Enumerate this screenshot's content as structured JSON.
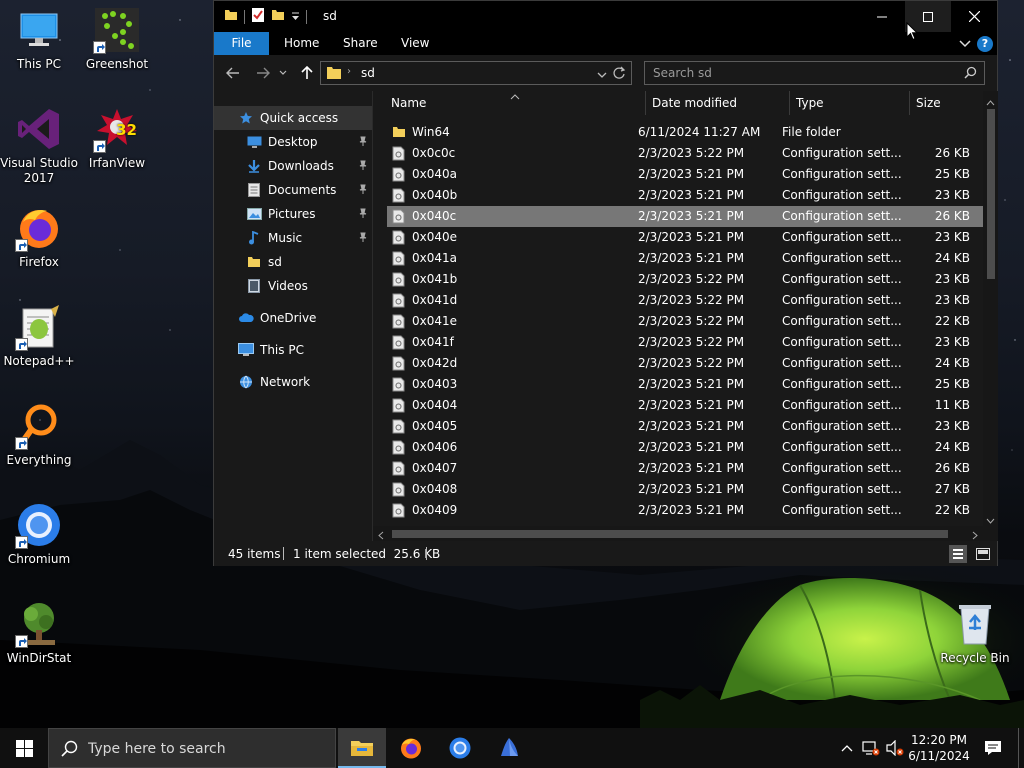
{
  "desktop": {
    "icons": [
      {
        "label": "This PC",
        "icon": "monitor-icon"
      },
      {
        "label": "Greenshot",
        "icon": "greenshot-icon"
      },
      {
        "label": "Visual Studio 2017",
        "icon": "visual-studio-icon"
      },
      {
        "label": "IrfanView",
        "icon": "irfanview-icon",
        "badge": "32"
      },
      {
        "label": "Firefox",
        "icon": "firefox-icon"
      },
      {
        "label": "Notepad++",
        "icon": "notepadpp-icon"
      },
      {
        "label": "Everything",
        "icon": "everything-icon"
      },
      {
        "label": "Chromium",
        "icon": "chromium-icon"
      },
      {
        "label": "WinDirStat",
        "icon": "windirstat-icon"
      },
      {
        "label": "Recycle Bin",
        "icon": "recycle-bin-icon"
      }
    ]
  },
  "explorer": {
    "title": "sd",
    "ribbon_tabs": [
      "File",
      "Home",
      "Share",
      "View"
    ],
    "help_label": "?",
    "address_path": "sd",
    "search_placeholder": "Search sd",
    "nav": [
      {
        "label": "Quick access",
        "icon": "star-icon",
        "pinned": false
      },
      {
        "label": "Desktop",
        "icon": "desktop-folder-icon",
        "pinned": true
      },
      {
        "label": "Downloads",
        "icon": "download-icon",
        "pinned": true
      },
      {
        "label": "Documents",
        "icon": "documents-icon",
        "pinned": true
      },
      {
        "label": "Pictures",
        "icon": "pictures-icon",
        "pinned": true
      },
      {
        "label": "Music",
        "icon": "music-icon",
        "pinned": true
      },
      {
        "label": "sd",
        "icon": "folder-icon",
        "pinned": false
      },
      {
        "label": "Videos",
        "icon": "videos-icon",
        "pinned": false
      },
      {
        "label": "OneDrive",
        "icon": "cloud-icon",
        "pinned": false
      },
      {
        "label": "This PC",
        "icon": "monitor-icon",
        "pinned": false
      },
      {
        "label": "Network",
        "icon": "network-icon",
        "pinned": false
      }
    ],
    "columns": {
      "name": "Name",
      "date": "Date modified",
      "type": "Type",
      "size": "Size"
    },
    "files": [
      {
        "name": "Win64",
        "date": "6/11/2024 11:27 AM",
        "type": "File folder",
        "size": "",
        "kind": "folder"
      },
      {
        "name": "0x0c0c",
        "date": "2/3/2023 5:22 PM",
        "type": "Configuration sett...",
        "size": "26 KB",
        "kind": "config"
      },
      {
        "name": "0x040a",
        "date": "2/3/2023 5:21 PM",
        "type": "Configuration sett...",
        "size": "25 KB",
        "kind": "config"
      },
      {
        "name": "0x040b",
        "date": "2/3/2023 5:21 PM",
        "type": "Configuration sett...",
        "size": "23 KB",
        "kind": "config"
      },
      {
        "name": "0x040c",
        "date": "2/3/2023 5:21 PM",
        "type": "Configuration sett...",
        "size": "26 KB",
        "kind": "config",
        "selected": true
      },
      {
        "name": "0x040e",
        "date": "2/3/2023 5:21 PM",
        "type": "Configuration sett...",
        "size": "23 KB",
        "kind": "config"
      },
      {
        "name": "0x041a",
        "date": "2/3/2023 5:21 PM",
        "type": "Configuration sett...",
        "size": "24 KB",
        "kind": "config"
      },
      {
        "name": "0x041b",
        "date": "2/3/2023 5:22 PM",
        "type": "Configuration sett...",
        "size": "23 KB",
        "kind": "config"
      },
      {
        "name": "0x041d",
        "date": "2/3/2023 5:22 PM",
        "type": "Configuration sett...",
        "size": "23 KB",
        "kind": "config"
      },
      {
        "name": "0x041e",
        "date": "2/3/2023 5:22 PM",
        "type": "Configuration sett...",
        "size": "22 KB",
        "kind": "config"
      },
      {
        "name": "0x041f",
        "date": "2/3/2023 5:22 PM",
        "type": "Configuration sett...",
        "size": "23 KB",
        "kind": "config"
      },
      {
        "name": "0x042d",
        "date": "2/3/2023 5:22 PM",
        "type": "Configuration sett...",
        "size": "24 KB",
        "kind": "config"
      },
      {
        "name": "0x0403",
        "date": "2/3/2023 5:21 PM",
        "type": "Configuration sett...",
        "size": "25 KB",
        "kind": "config"
      },
      {
        "name": "0x0404",
        "date": "2/3/2023 5:21 PM",
        "type": "Configuration sett...",
        "size": "11 KB",
        "kind": "config"
      },
      {
        "name": "0x0405",
        "date": "2/3/2023 5:21 PM",
        "type": "Configuration sett...",
        "size": "23 KB",
        "kind": "config"
      },
      {
        "name": "0x0406",
        "date": "2/3/2023 5:21 PM",
        "type": "Configuration sett...",
        "size": "24 KB",
        "kind": "config"
      },
      {
        "name": "0x0407",
        "date": "2/3/2023 5:21 PM",
        "type": "Configuration sett...",
        "size": "26 KB",
        "kind": "config"
      },
      {
        "name": "0x0408",
        "date": "2/3/2023 5:21 PM",
        "type": "Configuration sett...",
        "size": "27 KB",
        "kind": "config"
      },
      {
        "name": "0x0409",
        "date": "2/3/2023 5:21 PM",
        "type": "Configuration sett...",
        "size": "22 KB",
        "kind": "config"
      }
    ],
    "status": {
      "items": "45 items",
      "selected": "1 item selected  25.6 KB"
    }
  },
  "taskbar": {
    "search_placeholder": "Type here to search",
    "apps": [
      "file-explorer-icon",
      "firefox-icon",
      "chromium-icon",
      "app-icon"
    ],
    "time": "12:20 PM",
    "date": "6/11/2024"
  },
  "colors": {
    "accent": "#1979ca",
    "selection": "#777777",
    "window_bg": "#191919",
    "taskbar_bg": "#101010"
  }
}
